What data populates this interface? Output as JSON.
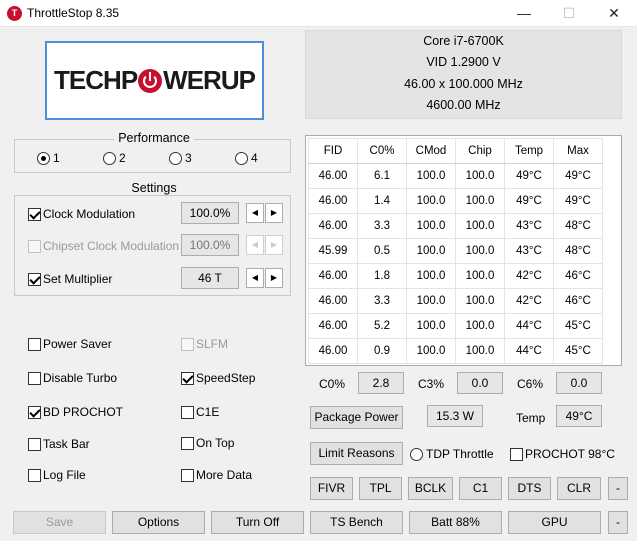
{
  "window": {
    "title": "ThrottleStop 8.35",
    "icon_letter": "T",
    "minimize": "—",
    "maximize": "☐",
    "close": "✕"
  },
  "logo": {
    "left": "TECHP",
    "right": "WERUP"
  },
  "cpu": {
    "name": "Core i7-6700K",
    "vid": "VID  1.2900 V",
    "multiplier": "46.00 x 100.000 MHz",
    "clock": "4600.00 MHz"
  },
  "performance": {
    "label": "Performance",
    "options": [
      {
        "label": "1",
        "selected": true
      },
      {
        "label": "2",
        "selected": false
      },
      {
        "label": "3",
        "selected": false
      },
      {
        "label": "4",
        "selected": false
      }
    ]
  },
  "settings": {
    "label": "Settings",
    "clock_modulation": {
      "label": "Clock Modulation",
      "value": "100.0%"
    },
    "chipset_clock_modulation": {
      "label": "Chipset Clock Modulation",
      "value": "100.0%"
    },
    "set_multiplier": {
      "label": "Set Multiplier",
      "value": "46 T"
    },
    "spin_left": "◀",
    "spin_right": "▶"
  },
  "options": {
    "power_saver": "Power Saver",
    "slfm": "SLFM",
    "disable_turbo": "Disable Turbo",
    "speedstep": "SpeedStep",
    "bd_prochot": "BD PROCHOT",
    "c1e": "C1E",
    "task_bar": "Task Bar",
    "on_top": "On Top",
    "log_file": "Log File",
    "more_data": "More Data"
  },
  "table": {
    "headers": [
      "FID",
      "C0%",
      "CMod",
      "Chip",
      "Temp",
      "Max"
    ],
    "rows": [
      [
        "46.00",
        "6.1",
        "100.0",
        "100.0",
        "49°C",
        "49°C"
      ],
      [
        "46.00",
        "1.4",
        "100.0",
        "100.0",
        "49°C",
        "49°C"
      ],
      [
        "46.00",
        "3.3",
        "100.0",
        "100.0",
        "43°C",
        "48°C"
      ],
      [
        "45.99",
        "0.5",
        "100.0",
        "100.0",
        "43°C",
        "48°C"
      ],
      [
        "46.00",
        "1.8",
        "100.0",
        "100.0",
        "42°C",
        "46°C"
      ],
      [
        "46.00",
        "3.3",
        "100.0",
        "100.0",
        "42°C",
        "46°C"
      ],
      [
        "46.00",
        "5.2",
        "100.0",
        "100.0",
        "44°C",
        "45°C"
      ],
      [
        "46.00",
        "0.9",
        "100.0",
        "100.0",
        "44°C",
        "45°C"
      ]
    ]
  },
  "status": {
    "c0_label": "C0%",
    "c0_value": "2.8",
    "c3_label": "C3%",
    "c3_value": "0.0",
    "c6_label": "C6%",
    "c6_value": "0.0",
    "package_power_button": "Package Power",
    "package_power_value": "15.3 W",
    "temp_label": "Temp",
    "temp_value": "49°C",
    "limit_reasons_button": "Limit Reasons",
    "tdp_throttle": "TDP Throttle",
    "prochot": "PROCHOT 98°C"
  },
  "toolbar": {
    "fivr": "FIVR",
    "tpl": "TPL",
    "bclk": "BCLK",
    "c1": "C1",
    "dts": "DTS",
    "clr": "CLR",
    "dash1": "-"
  },
  "bottom": {
    "save": "Save",
    "options": "Options",
    "turn_off": "Turn Off",
    "ts_bench": "TS Bench",
    "batt": "Batt 88%",
    "gpu": "GPU",
    "dash2": "-"
  }
}
